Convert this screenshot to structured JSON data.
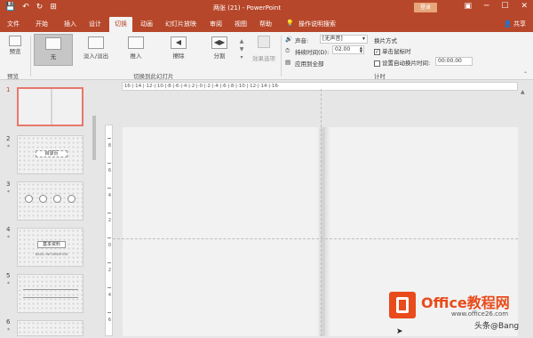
{
  "titlebar": {
    "title": "两张 (21) - PowerPoint",
    "login": "登录",
    "qat": [
      "💾",
      "↶",
      "↻",
      "⊞"
    ]
  },
  "tabs": [
    "文件",
    "开始",
    "插入",
    "设计",
    "切换",
    "动画",
    "幻灯片放映",
    "审阅",
    "视图",
    "帮助",
    "操作说明搜索"
  ],
  "active_tab": "切换",
  "share": "共享",
  "ribbon": {
    "preview_label": "预览",
    "preview_group": "预览",
    "transitions": [
      {
        "label": "无"
      },
      {
        "label": "淡入/淡出"
      },
      {
        "label": "推入"
      },
      {
        "label": "擦除"
      },
      {
        "label": "分割"
      }
    ],
    "effects_label": "效果选项",
    "transitions_group": "切换到此幻灯片",
    "sound_label": "声音:",
    "sound_value": "[无声音]",
    "duration_label": "持续时间(D):",
    "duration_value": "02.00",
    "apply_all": "应用到全部",
    "advance_title": "换片方式",
    "on_click": "单击鼠标时",
    "after_label": "设置自动换片时间:",
    "after_value": "00:00.00",
    "timing_group": "计时"
  },
  "slides": [
    {
      "num": "1",
      "star": "",
      "label": "",
      "sub": ""
    },
    {
      "num": "2",
      "star": "*",
      "label": "目录页",
      "sub": ""
    },
    {
      "num": "3",
      "star": "*",
      "label": "",
      "sub": ""
    },
    {
      "num": "4",
      "star": "*",
      "label": "基本资料",
      "sub": "BASIC INFORMATION"
    },
    {
      "num": "5",
      "star": "*",
      "label": "",
      "sub": ""
    },
    {
      "num": "6",
      "star": "*",
      "label": "",
      "sub": ""
    }
  ],
  "ruler": "·16·|·14·|·12·|·10·|·8·|·6·|·4·|·2·|·0·|·2·|·4·|·6·|·8·|·10·|·12·|·14·|·16·",
  "vruler": [
    "8",
    "6",
    "4",
    "2",
    "0",
    "2",
    "4",
    "6"
  ],
  "watermark": {
    "brand": "Office教程网",
    "url": "www.office26.com",
    "handle": "头条@Bang"
  }
}
